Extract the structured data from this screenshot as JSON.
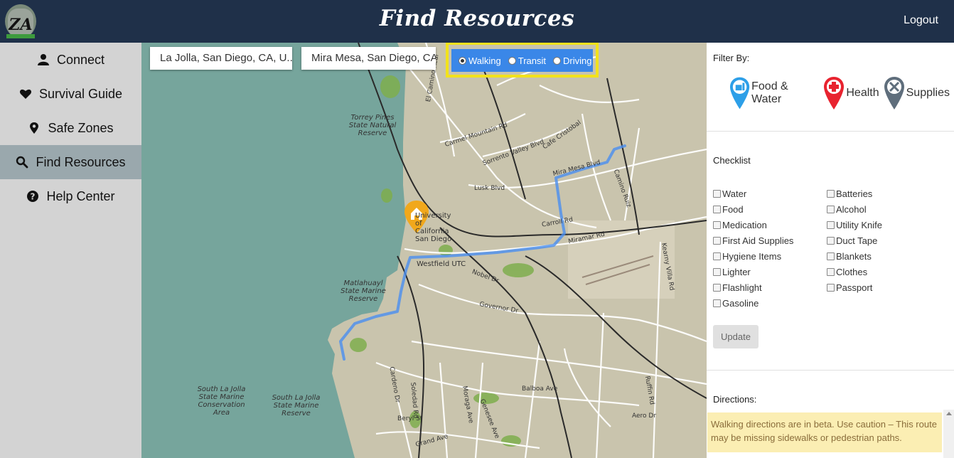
{
  "header": {
    "title": "Find Resources",
    "logout_label": "Logout",
    "logo_text": "ZA"
  },
  "sidebar": {
    "items": [
      {
        "label": "Connect",
        "icon": "user-icon"
      },
      {
        "label": "Survival Guide",
        "icon": "heart-icon"
      },
      {
        "label": "Safe Zones",
        "icon": "map-marker-icon"
      },
      {
        "label": "Find Resources",
        "icon": "search-icon",
        "active": true
      },
      {
        "label": "Help Center",
        "icon": "question-circle-icon"
      }
    ]
  },
  "map": {
    "origin_value": "La Jolla, San Diego, CA, U...",
    "destination_value": "Mira Mesa, San Diego, CA...",
    "travel_modes": [
      {
        "label": "Walking",
        "selected": true
      },
      {
        "label": "Transit",
        "selected": false
      },
      {
        "label": "Driving",
        "selected": false
      }
    ],
    "area_labels": [
      "Torrey Pines State Natural Reserve",
      "Matlahuayl State Marine Reserve",
      "South La Jolla State Marine Conservation Area",
      "South La Jolla State Marine Reserve"
    ],
    "street_labels": [
      "Carmel Mountain Rd",
      "Sorrento Valley Blvd",
      "Mira Mesa Blvd",
      "Lusk Blvd",
      "Carroll Rd",
      "Miramar Rd",
      "Camino Ruiz",
      "Genesee Ave",
      "Governor Dr",
      "Balboa Ave",
      "Aero Dr",
      "Grand Ave",
      "Beryl St",
      "Westfield UTC",
      "Kearny Villa Rd",
      "Cardeno Dr",
      "Soledad Rd",
      "Moraga Ave",
      "Ruffin Rd",
      "Nobel Dr",
      "Cafe Cristobal",
      "El Camino Real",
      "University of California San Diego"
    ],
    "accent_route_color": "#4a8ff0",
    "highlight_color": "#f2e21c"
  },
  "panel": {
    "filter_title": "Filter By:",
    "filters": [
      {
        "label": "Food & Water",
        "color": "#2d9fe8",
        "icon": "food-water-pin-icon"
      },
      {
        "label": "Health",
        "color": "#e8232f",
        "icon": "health-pin-icon"
      },
      {
        "label": "Supplies",
        "color": "#5f6e7c",
        "icon": "supplies-pin-icon"
      }
    ],
    "checklist_title": "Checklist",
    "checklist_left": [
      "Water",
      "Food",
      "Medication",
      "First Aid Supplies",
      "Hygiene Items",
      "Lighter",
      "Flashlight",
      "Gasoline"
    ],
    "checklist_right": [
      "Batteries",
      "Alcohol",
      "Utility Knife",
      "Duct Tape",
      "Blankets",
      "Clothes",
      "Passport"
    ],
    "update_label": "Update",
    "directions_title": "Directions:",
    "warning_text": "Walking directions are in beta. Use caution – This route may be missing sidewalks or pedestrian paths."
  }
}
